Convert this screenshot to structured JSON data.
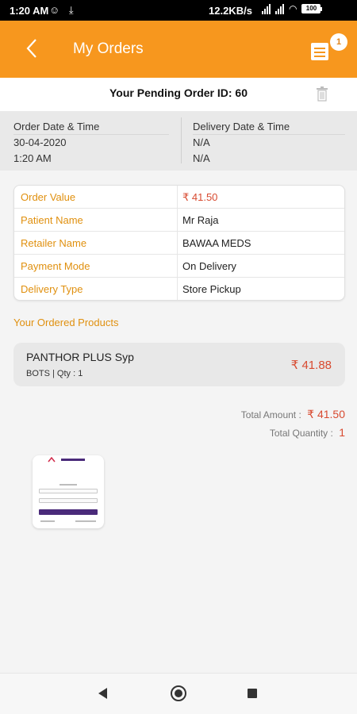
{
  "status_bar": {
    "time": "1:20 AM",
    "speed": "12.2KB/s",
    "battery": "100"
  },
  "app_bar": {
    "title": "My Orders",
    "cart_badge": "1"
  },
  "order": {
    "pending_label": "Your Pending Order ID: 60",
    "order_date_label": "Order Date & Time",
    "order_date": "30-04-2020",
    "order_time": "1:20 AM",
    "delivery_date_label": "Delivery Date & Time",
    "delivery_date": "N/A",
    "delivery_time": "N/A"
  },
  "details": [
    {
      "label": "Order Value",
      "value": "₹ 41.50"
    },
    {
      "label": "Patient Name",
      "value": "Mr Raja"
    },
    {
      "label": "Retailer Name",
      "value": "BAWAA MEDS"
    },
    {
      "label": "Payment Mode",
      "value": "On Delivery"
    },
    {
      "label": "Delivery Type",
      "value": "Store Pickup"
    }
  ],
  "products_section_label": "Your Ordered Products",
  "products": [
    {
      "name": "PANTHOR PLUS Syp",
      "meta": "BOTS | Qty : 1",
      "price": "₹ 41.88"
    }
  ],
  "totals": {
    "amount_label": "Total Amount :",
    "amount": "₹ 41.50",
    "quantity_label": "Total Quantity :",
    "quantity": "1"
  },
  "colors": {
    "accent": "#f7971e",
    "label": "#e0900f",
    "price": "#d84a30"
  },
  "icons": {
    "back": "chevron-left-icon",
    "cart": "cart-icon",
    "delete": "trash-icon",
    "nav_back": "triangle-back-icon",
    "nav_home": "circle-home-icon",
    "nav_recent": "square-recent-icon"
  }
}
